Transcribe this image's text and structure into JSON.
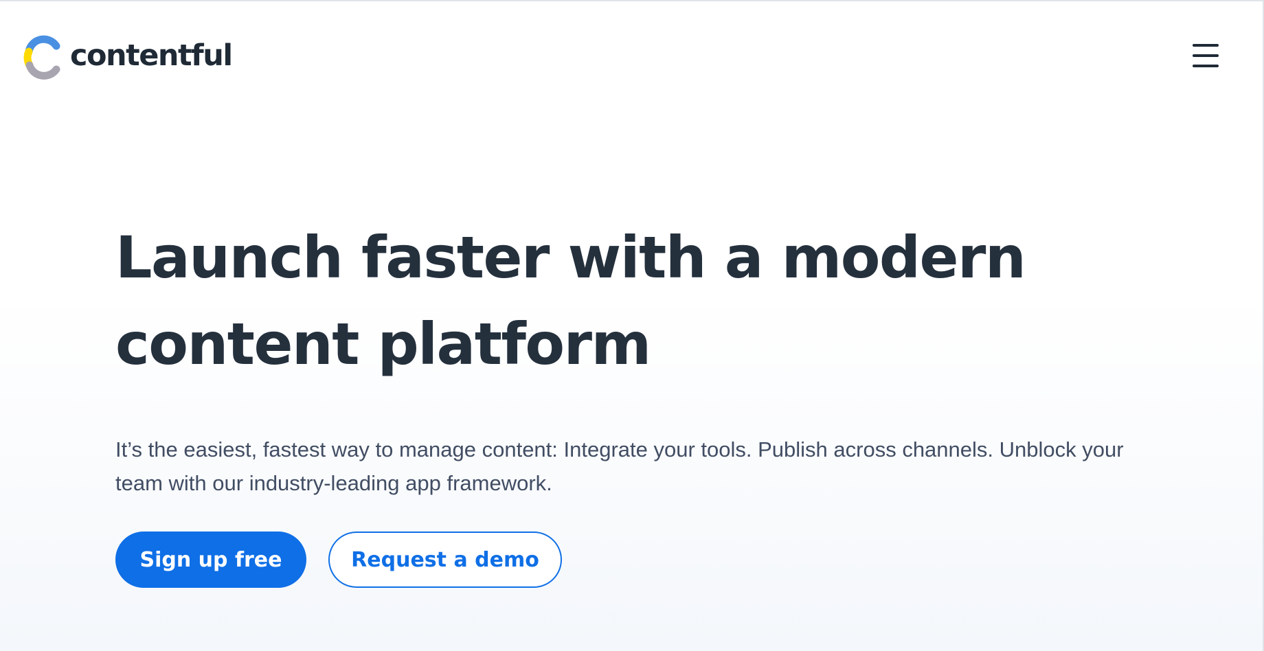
{
  "brand": {
    "name": "contentful",
    "logo_colors": {
      "yellow": "#FFDA00",
      "blue": "#4A90E2",
      "gray": "#A8A4B0"
    }
  },
  "header": {
    "menu_icon": "hamburger-menu-icon"
  },
  "hero": {
    "title": "Launch faster with a modern content platform",
    "subtitle": "It’s the easiest, fastest way to manage content: Integrate your tools. Publish across channels. Unblock your team with our industry-leading app framework.",
    "primary_cta": "Sign up free",
    "secondary_cta": "Request a demo"
  },
  "colors": {
    "accent": "#0F6FE6",
    "heading": "#25303D",
    "body_text": "#414D63"
  }
}
